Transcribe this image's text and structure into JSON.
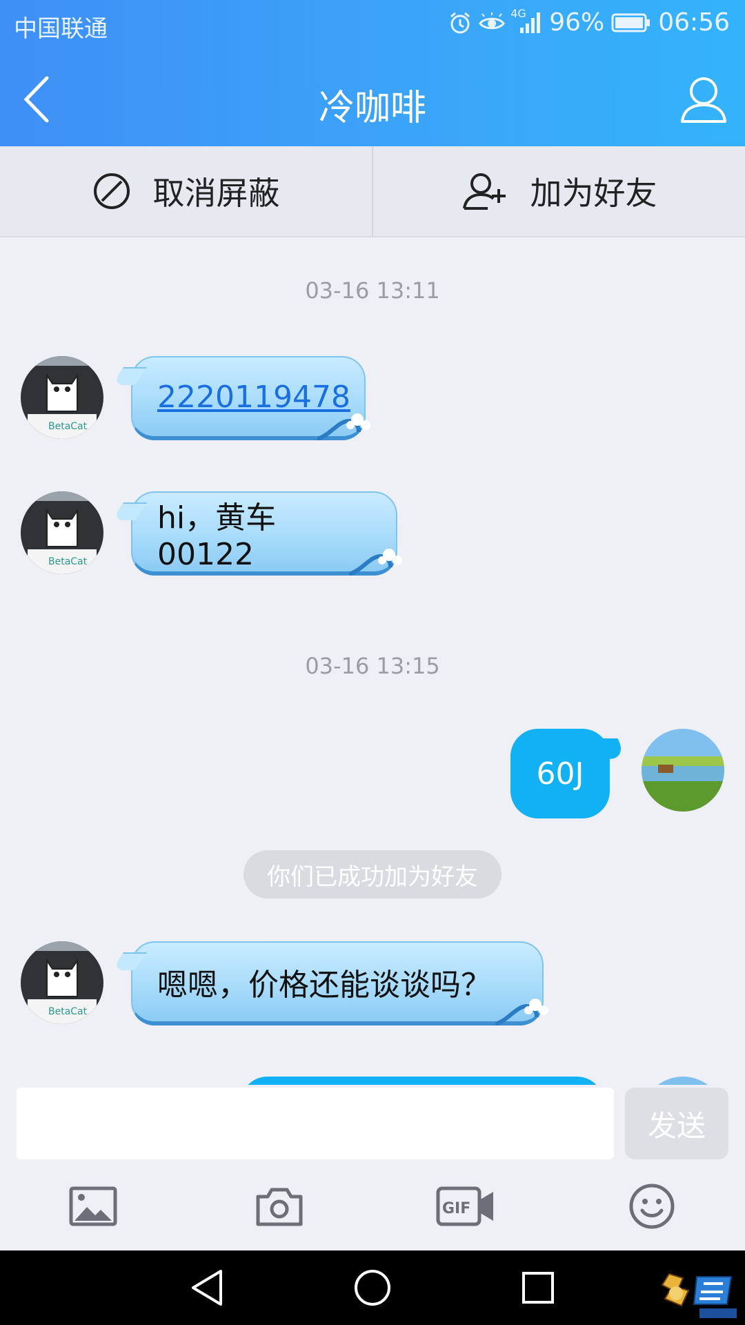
{
  "status_bar": {
    "carrier": "中国联通",
    "network": "4G",
    "battery": "96%",
    "time": "06:56"
  },
  "title_bar": {
    "title": "冷咖啡",
    "back_icon": "chevron-left-icon",
    "profile_icon": "user-icon"
  },
  "actions": {
    "unblock_label": "取消屏蔽",
    "unblock_icon": "block-icon",
    "add_friend_label": "加为好友",
    "add_friend_icon": "add-user-icon"
  },
  "chat": {
    "timestamp_1": "03-16 13:11",
    "message_1": "2220119478",
    "message_2": "hi，黄车00122",
    "timestamp_2": "03-16 13:15",
    "message_3": "60J",
    "system_notice": "你们已成功加为好友",
    "message_4": "嗯嗯，价格还能谈谈吗？",
    "contact_avatar_label": "BetaCat"
  },
  "input": {
    "value": "",
    "send_label": "发送"
  },
  "toolbar": {
    "icons": [
      "image-icon",
      "camera-icon",
      "gif-icon",
      "emoji-icon"
    ]
  },
  "nav": {
    "icons": [
      "back-triangle-icon",
      "home-circle-icon",
      "recents-square-icon"
    ]
  },
  "colors": {
    "header_gradient_start": "#3f8ff6",
    "header_gradient_end": "#34b3fa",
    "incoming_bubble": "#a9dcfb",
    "outgoing_bubble": "#12b1f3",
    "link": "#1a6fe0",
    "background": "#eef0f6"
  }
}
